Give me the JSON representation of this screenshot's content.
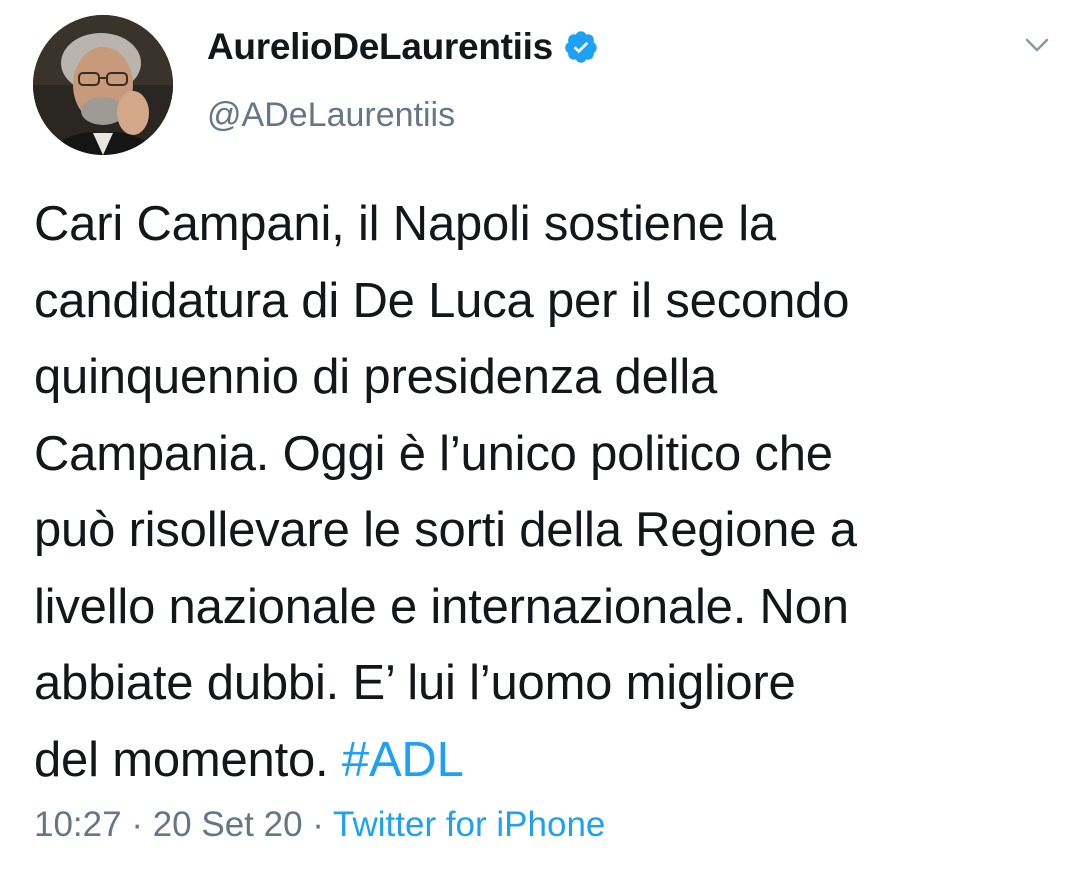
{
  "author": {
    "display_name": "AurelioDeLaurentiis",
    "handle": "@ADeLaurentiis",
    "verified_icon": "verified-badge-icon",
    "avatar_icon": "avatar-photo"
  },
  "menu": {
    "icon": "chevron-down-icon"
  },
  "tweet": {
    "lines": [
      "Cari Campani, il Napoli sostiene la",
      "candidatura di De Luca per il secondo",
      "quinquennio di presidenza della",
      "Campania. Oggi è l’unico politico che",
      "può risollevare le sorti della Regione a",
      "livello nazionale e internazionale. Non",
      "abbiate dubbi. E’ lui l’uomo migliore",
      "del momento. "
    ],
    "hashtag": "#ADL"
  },
  "meta": {
    "time": "10:27",
    "separator1": " · ",
    "date": "20 Set 20",
    "separator2": " · ",
    "source": "Twitter for iPhone"
  },
  "colors": {
    "accent": "#1da1f2",
    "muted": "#657786",
    "text": "#14171a"
  }
}
